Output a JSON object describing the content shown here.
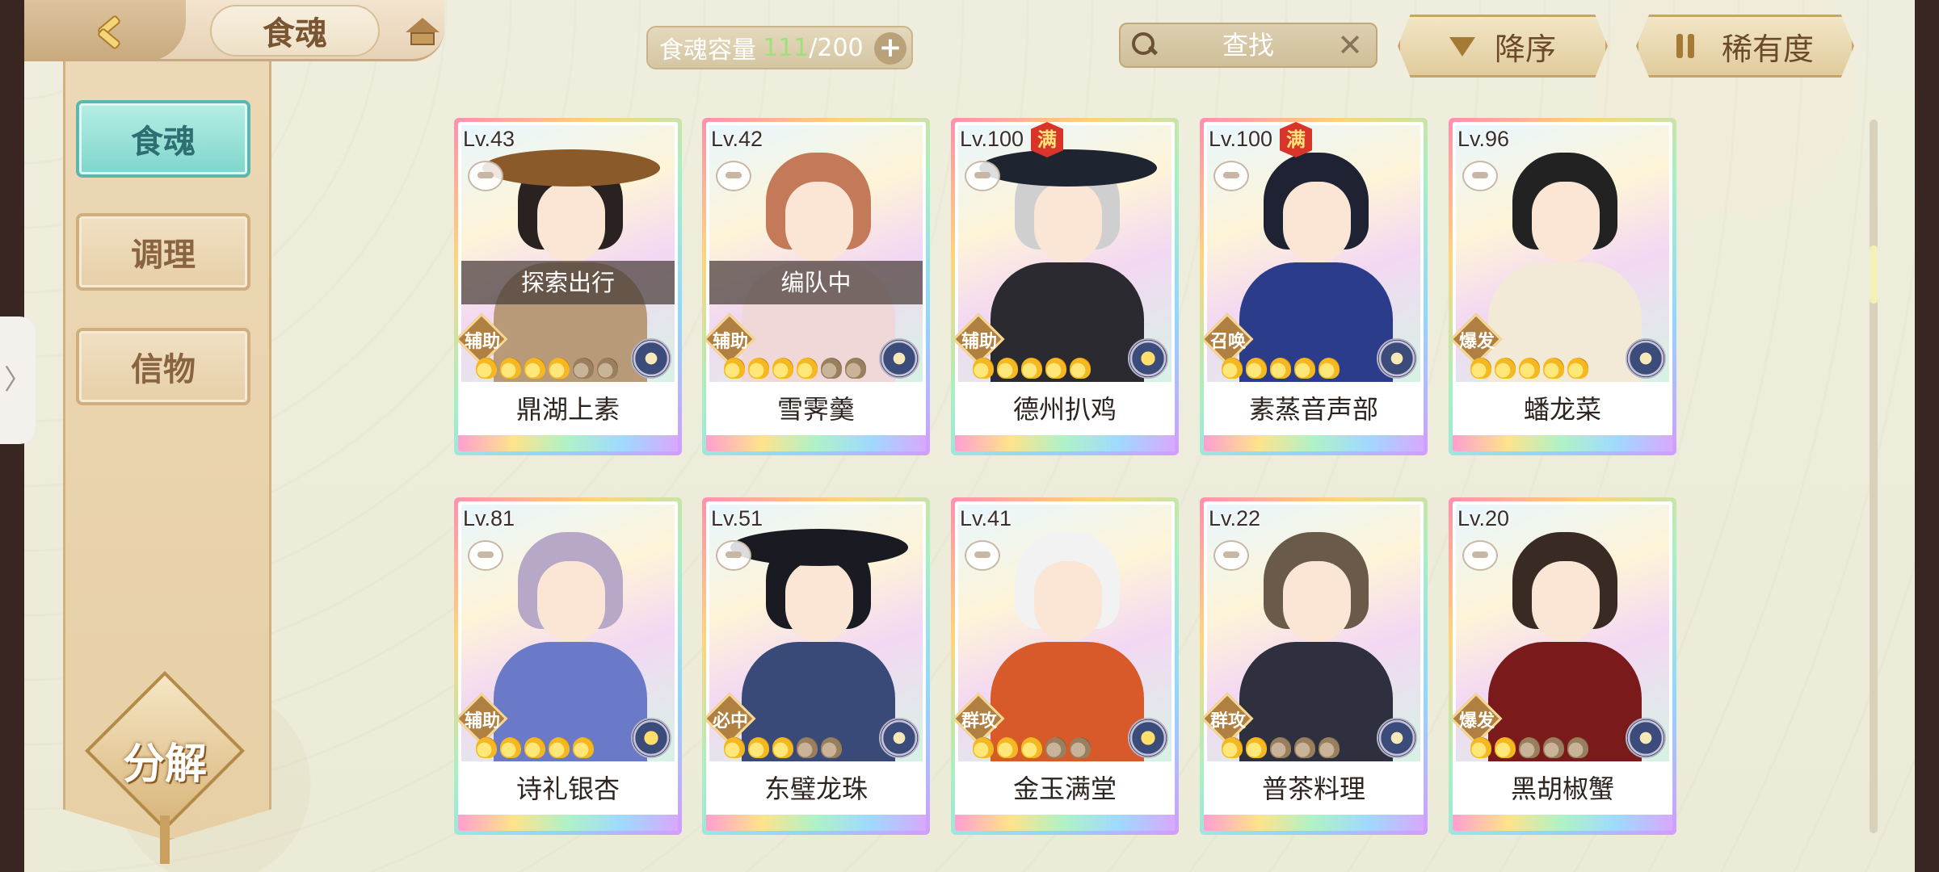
{
  "header": {
    "title": "食魂",
    "capacity_label": "食魂容量",
    "capacity_current": "111",
    "capacity_separator": "/",
    "capacity_max": "200",
    "capacity_add": "+"
  },
  "search": {
    "placeholder": "查找",
    "clear": "✕"
  },
  "sort": {
    "order_label": "降序",
    "rarity_label": "稀有度"
  },
  "sidebar": {
    "items": [
      {
        "label": "食魂",
        "active": true
      },
      {
        "label": "调理",
        "active": false
      },
      {
        "label": "信物",
        "active": false
      }
    ],
    "decompose_label": "分解"
  },
  "edge_tab": "〉",
  "cards": [
    {
      "level": "Lv.43",
      "name": "鼎湖上素",
      "role": "辅助",
      "status": "探索出行",
      "stars_on": 4,
      "stars_total": 6,
      "max": "",
      "element": "blue"
    },
    {
      "level": "Lv.42",
      "name": "雪霁羹",
      "role": "辅助",
      "status": "编队中",
      "stars_on": 4,
      "stars_total": 6,
      "max": "",
      "element": "blue"
    },
    {
      "level": "Lv.100",
      "name": "德州扒鸡",
      "role": "辅助",
      "status": "",
      "stars_on": 5,
      "stars_total": 5,
      "max": "满",
      "element": "gold"
    },
    {
      "level": "Lv.100",
      "name": "素蒸音声部",
      "role": "召唤",
      "status": "",
      "stars_on": 5,
      "stars_total": 5,
      "max": "满",
      "element": "blue"
    },
    {
      "level": "Lv.96",
      "name": "蟠龙菜",
      "role": "爆发",
      "status": "",
      "stars_on": 5,
      "stars_total": 5,
      "max": "",
      "element": "blue"
    },
    {
      "level": "Lv.81",
      "name": "诗礼银杏",
      "role": "辅助",
      "status": "",
      "stars_on": 5,
      "stars_total": 5,
      "max": "",
      "element": "gold"
    },
    {
      "level": "Lv.51",
      "name": "东璧龙珠",
      "role": "必中",
      "status": "",
      "stars_on": 3,
      "stars_total": 5,
      "max": "",
      "element": "blue"
    },
    {
      "level": "Lv.41",
      "name": "金玉满堂",
      "role": "群攻",
      "status": "",
      "stars_on": 3,
      "stars_total": 5,
      "max": "",
      "element": "gold"
    },
    {
      "level": "Lv.22",
      "name": "普茶料理",
      "role": "群攻",
      "status": "",
      "stars_on": 2,
      "stars_total": 5,
      "max": "",
      "element": "blue"
    },
    {
      "level": "Lv.20",
      "name": "黑胡椒蟹",
      "role": "爆发",
      "status": "",
      "stars_on": 2,
      "stars_total": 5,
      "max": "",
      "element": "blue"
    }
  ],
  "colors": {
    "accent_teal": "#7ed6cc",
    "panel_tan": "#e7cfa5",
    "capacity_green": "#9fe07a"
  },
  "icons": [
    "back-icon",
    "home-icon",
    "search-icon",
    "clear-icon",
    "sort-desc-icon",
    "sort-rarity-icon",
    "add-icon"
  ]
}
